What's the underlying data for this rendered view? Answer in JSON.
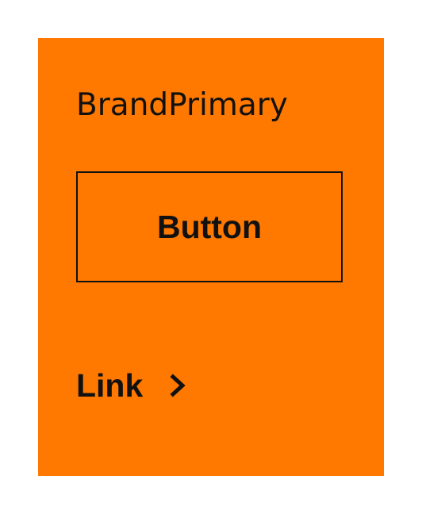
{
  "card": {
    "title": "BrandPrimary",
    "background_color": "#FF7800",
    "text_color": "#111111"
  },
  "button": {
    "label": "Button"
  },
  "link": {
    "label": "Link",
    "icon": "chevron-right-icon"
  }
}
